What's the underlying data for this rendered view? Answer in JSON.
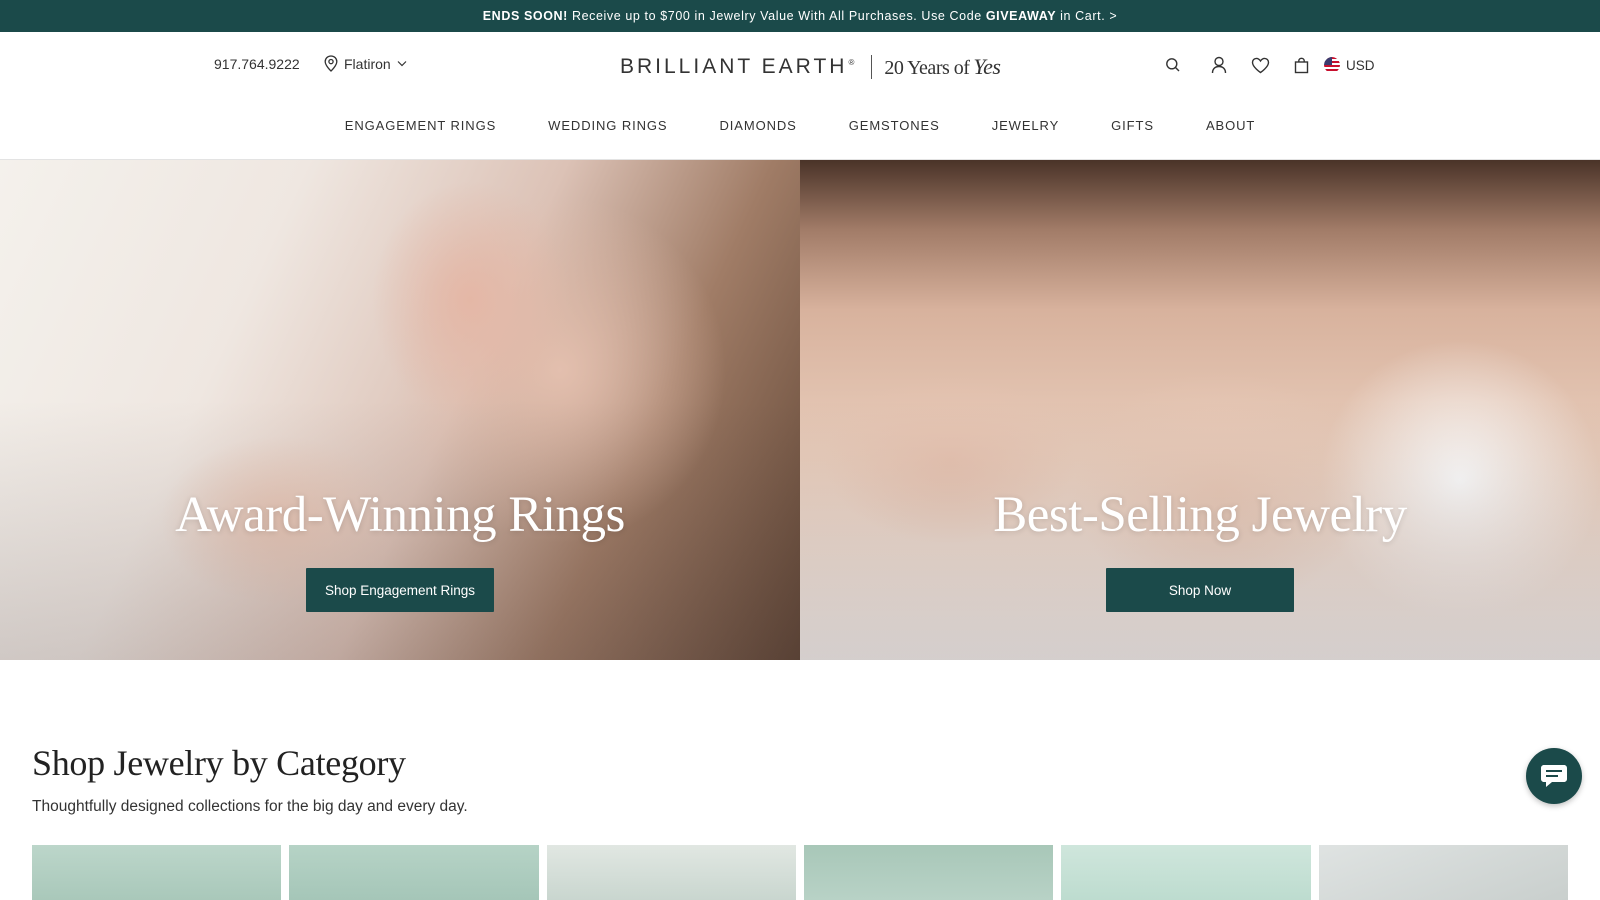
{
  "promo": {
    "lead": "ENDS SOON!",
    "text": "Receive up to $700 in Jewelry Value With All Purchases. Use Code",
    "code": "GIVEAWAY",
    "tail": "in Cart. >"
  },
  "header": {
    "phone": "917.764.9222",
    "store": "Flatiron",
    "logo": {
      "brand": "BRILLIANT EARTH",
      "reg": "®",
      "years": "20 Years of",
      "yes": "Yes"
    },
    "currency": "USD",
    "icons": [
      "search-icon",
      "account-icon",
      "heart-icon",
      "bag-icon",
      "us-flag-icon"
    ]
  },
  "nav": {
    "items": [
      "ENGAGEMENT RINGS",
      "WEDDING RINGS",
      "DIAMONDS",
      "GEMSTONES",
      "JEWELRY",
      "GIFTS",
      "ABOUT"
    ]
  },
  "hero": {
    "left": {
      "title": "Award-Winning Rings",
      "button": "Shop Engagement Rings"
    },
    "right": {
      "title": "Best-Selling Jewelry",
      "button": "Shop Now"
    }
  },
  "category": {
    "title": "Shop Jewelry by Category",
    "subtitle": "Thoughtfully designed collections for the big day and every day."
  },
  "colors": {
    "brand": "#1b4a4a",
    "text": "#222222"
  }
}
